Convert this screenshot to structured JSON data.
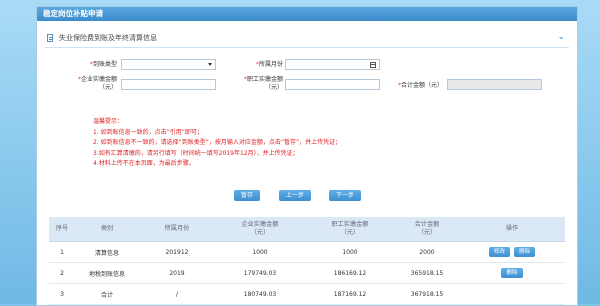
{
  "page": {
    "title": "稳定岗位补贴申请",
    "section_title": "失业保险费到账及年终清算信息"
  },
  "form": {
    "arrival_type_label": "到账类型",
    "period_label": "所属月份",
    "company_amount_label_1": "企业实缴金额",
    "company_amount_label_2": "（元）",
    "employee_amount_label_1": "职工实缴金额",
    "employee_amount_label_2": "（元）",
    "total_label": "合计金额（元）",
    "required_mark": "*"
  },
  "tips": {
    "title": "温馨提示：",
    "lines": [
      "1. 如到账信息一致的，点击“引用”即可；",
      "2. 如到账信息不一致的，请选择“到账类型”，按月输入对应金额，点击“暂存”，并上传凭证；",
      "3.如有汇算清缴的，请另行填写（时间统一填写2019年12月），并上传凭证；",
      "4.材料上传不在本页面，为最后步骤。"
    ]
  },
  "buttons": {
    "save": "暂存",
    "prev": "上一步",
    "next": "下一步"
  },
  "table": {
    "headers": {
      "seq": "序号",
      "type": "类别",
      "month": "所属月份",
      "company_1": "企业实缴金额",
      "company_2": "（元）",
      "employee_1": "职工实缴金额",
      "employee_2": "（元）",
      "total_1": "合计金额",
      "total_2": "（元）",
      "ops": "操作"
    },
    "rows": [
      {
        "seq": "1",
        "type": "清算信息",
        "month": "201912",
        "company": "1000",
        "employee": "1000",
        "total": "2000",
        "op1": "修改",
        "op2": "删除"
      },
      {
        "seq": "2",
        "type": "地税到账信息",
        "month": "2019",
        "company": "179749.03",
        "employee": "186169.12",
        "total": "365918.15",
        "op1": "删除"
      },
      {
        "seq": "3",
        "type": "合计",
        "month": "/",
        "company": "180749.03",
        "employee": "187169.12",
        "total": "367918.15"
      }
    ]
  }
}
